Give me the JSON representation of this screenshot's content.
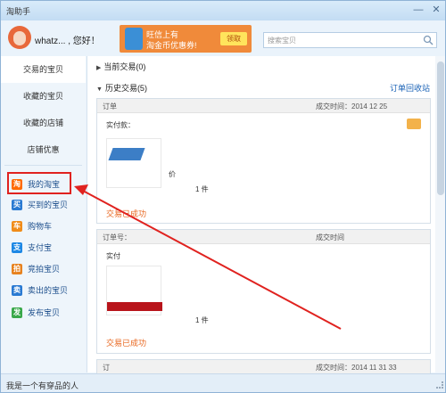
{
  "window": {
    "title": "淘助手",
    "min_glyph": "—",
    "close_glyph": "✕"
  },
  "header": {
    "greeting": "whatz... , 您好！",
    "promo": {
      "line1": "旺信上有",
      "line2": "淘金币优惠券!",
      "button": "领取"
    },
    "search": {
      "placeholder": "搜索宝贝"
    }
  },
  "sidebar": {
    "top_items": [
      {
        "label": "交易的宝贝"
      },
      {
        "label": "收藏的宝贝"
      },
      {
        "label": "收藏的店铺"
      },
      {
        "label": "店铺优惠"
      }
    ],
    "items": [
      {
        "label": "我的淘宝",
        "icon": "taobao-icon",
        "color": "#ff6a00",
        "glyph": "淘"
      },
      {
        "label": "买到的宝贝",
        "icon": "bought-icon",
        "color": "#2a7ad2",
        "glyph": "买"
      },
      {
        "label": "购物车",
        "icon": "cart-icon",
        "color": "#f08c1a",
        "glyph": "车"
      },
      {
        "label": "支付宝",
        "icon": "alipay-icon",
        "color": "#1e88e5",
        "glyph": "支"
      },
      {
        "label": "竞拍宝贝",
        "icon": "auction-icon",
        "color": "#e7821f",
        "glyph": "拍"
      },
      {
        "label": "卖出的宝贝",
        "icon": "sold-icon",
        "color": "#2a7ad2",
        "glyph": "卖"
      },
      {
        "label": "发布宝贝",
        "icon": "publish-icon",
        "color": "#3aa84a",
        "glyph": "发"
      }
    ]
  },
  "main": {
    "current_trades": "当前交易(0)",
    "history_trades": "历史交易(5)",
    "recycle_bin": "订单回收站",
    "orders": [
      {
        "no": "订单",
        "time": "成交时间：2014 12 25",
        "paid": "实付款：",
        "price_label": "价",
        "qty": "1 件",
        "status": "交易已成功"
      },
      {
        "no": "订单号：",
        "time": "成交时间",
        "paid": "实付",
        "price_label": "",
        "qty": "1 件",
        "status": "交易已成功"
      },
      {
        "no": "订",
        "time": "成交时间：2014 11 31 33",
        "paid": "",
        "price_label": "",
        "qty": "",
        "status": ""
      }
    ]
  },
  "statusbar": {
    "text": "我是一个有穿品的人"
  },
  "colors": {
    "accent": "#1a62b6",
    "highlight": "#e0221f",
    "status": "#e8661e",
    "promo": "#f08a3a"
  }
}
